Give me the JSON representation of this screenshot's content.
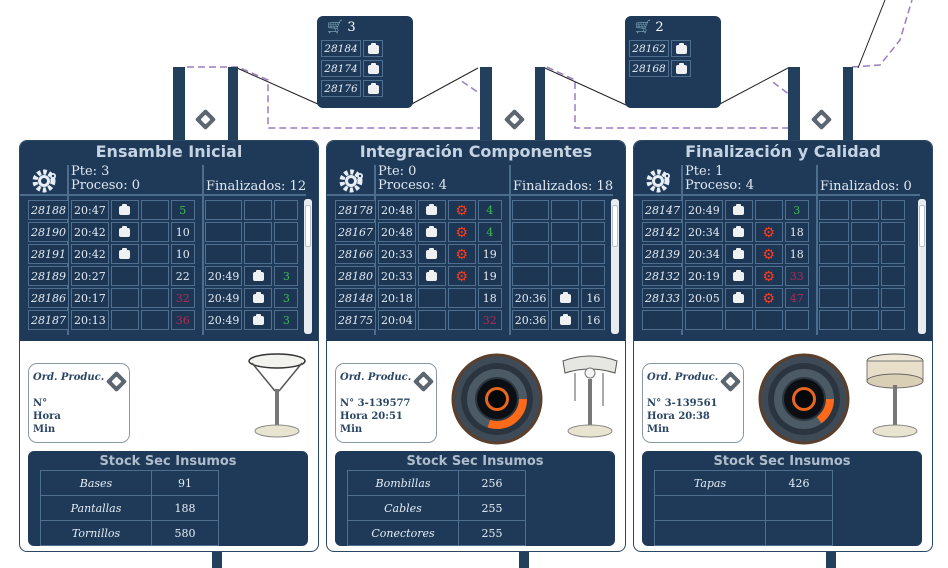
{
  "racks": [
    {
      "count": "3",
      "items": [
        "28184",
        "28174",
        "28176"
      ]
    },
    {
      "count": "2",
      "items": [
        "28162",
        "28168"
      ]
    }
  ],
  "stations": [
    {
      "title": "Ensamble Inicial",
      "pte": "Pte: 3",
      "proceso": "Proceso: 0",
      "finalizados": "Finalizados: 12",
      "rows": [
        {
          "id": "28188",
          "time": "20:47",
          "box": true,
          "gear": false,
          "num": "5",
          "numColor": "green",
          "ftime": "",
          "fbox": false,
          "fnum": "",
          "fnumColor": ""
        },
        {
          "id": "28190",
          "time": "20:42",
          "box": true,
          "gear": false,
          "num": "10",
          "numColor": "white",
          "ftime": "",
          "fbox": false,
          "fnum": "",
          "fnumColor": ""
        },
        {
          "id": "28191",
          "time": "20:42",
          "box": true,
          "gear": false,
          "num": "10",
          "numColor": "white",
          "ftime": "",
          "fbox": false,
          "fnum": "",
          "fnumColor": ""
        },
        {
          "id": "28189",
          "time": "20:27",
          "box": false,
          "gear": false,
          "num": "22",
          "numColor": "white",
          "ftime": "20:49",
          "fbox": true,
          "fnum": "3",
          "fnumColor": "green"
        },
        {
          "id": "28186",
          "time": "20:17",
          "box": false,
          "gear": false,
          "num": "32",
          "numColor": "red",
          "ftime": "20:49",
          "fbox": true,
          "fnum": "3",
          "fnumColor": "green"
        },
        {
          "id": "28187",
          "time": "20:13",
          "box": false,
          "gear": false,
          "num": "36",
          "numColor": "red",
          "ftime": "20:49",
          "fbox": true,
          "fnum": "3",
          "fnumColor": "green"
        }
      ],
      "order": {
        "title": "Ord. Produc.",
        "line1": "N°",
        "line2": "Hora",
        "line3": "Min"
      },
      "dial": null,
      "stock": {
        "title": "Stock Sec Insumos",
        "items": [
          {
            "name": "Bases",
            "value": "91"
          },
          {
            "name": "Pantallas",
            "value": "188"
          },
          {
            "name": "Tornillos",
            "value": "580"
          }
        ]
      }
    },
    {
      "title": "Integración Componentes",
      "pte": "Pte: 0",
      "proceso": "Proceso: 4",
      "finalizados": "Finalizados: 18",
      "rows": [
        {
          "id": "28178",
          "time": "20:48",
          "box": true,
          "gear": true,
          "num": "4",
          "numColor": "green",
          "ftime": "",
          "fbox": false,
          "fnum": "",
          "fnumColor": ""
        },
        {
          "id": "28167",
          "time": "20:48",
          "box": true,
          "gear": true,
          "num": "4",
          "numColor": "green",
          "ftime": "",
          "fbox": false,
          "fnum": "",
          "fnumColor": ""
        },
        {
          "id": "28166",
          "time": "20:33",
          "box": true,
          "gear": true,
          "num": "19",
          "numColor": "white",
          "ftime": "",
          "fbox": false,
          "fnum": "",
          "fnumColor": ""
        },
        {
          "id": "28180",
          "time": "20:33",
          "box": true,
          "gear": true,
          "num": "19",
          "numColor": "white",
          "ftime": "",
          "fbox": false,
          "fnum": "",
          "fnumColor": ""
        },
        {
          "id": "28148",
          "time": "20:18",
          "box": false,
          "gear": false,
          "num": "18",
          "numColor": "white",
          "ftime": "20:36",
          "fbox": true,
          "fnum": "16",
          "fnumColor": "white"
        },
        {
          "id": "28175",
          "time": "20:04",
          "box": false,
          "gear": false,
          "num": "32",
          "numColor": "red",
          "ftime": "20:36",
          "fbox": true,
          "fnum": "16",
          "fnumColor": "white"
        }
      ],
      "order": {
        "title": "Ord. Produc.",
        "line1": "N° 3-139577",
        "line2": "Hora 20:51",
        "line3": "Min"
      },
      "dial": {
        "progress": 0.3
      },
      "stock": {
        "title": "Stock Sec Insumos",
        "items": [
          {
            "name": "Bombillas",
            "value": "256"
          },
          {
            "name": "Cables",
            "value": "255"
          },
          {
            "name": "Conectores",
            "value": "255"
          }
        ]
      }
    },
    {
      "title": "Finalización y Calidad",
      "pte": "Pte: 1",
      "proceso": "Proceso: 4",
      "finalizados": "Finalizados: 0",
      "rows": [
        {
          "id": "28147",
          "time": "20:49",
          "box": true,
          "gear": false,
          "num": "3",
          "numColor": "green",
          "ftime": "",
          "fbox": false,
          "fnum": "",
          "fnumColor": ""
        },
        {
          "id": "28142",
          "time": "20:34",
          "box": true,
          "gear": true,
          "num": "18",
          "numColor": "white",
          "ftime": "",
          "fbox": false,
          "fnum": "",
          "fnumColor": ""
        },
        {
          "id": "28139",
          "time": "20:34",
          "box": true,
          "gear": true,
          "num": "18",
          "numColor": "white",
          "ftime": "",
          "fbox": false,
          "fnum": "",
          "fnumColor": ""
        },
        {
          "id": "28132",
          "time": "20:19",
          "box": true,
          "gear": true,
          "num": "33",
          "numColor": "red",
          "ftime": "",
          "fbox": false,
          "fnum": "",
          "fnumColor": ""
        },
        {
          "id": "28133",
          "time": "20:05",
          "box": true,
          "gear": true,
          "num": "47",
          "numColor": "red",
          "ftime": "",
          "fbox": false,
          "fnum": "",
          "fnumColor": ""
        },
        {
          "id": "",
          "time": "",
          "box": false,
          "gear": false,
          "num": "",
          "numColor": "white",
          "ftime": "",
          "fbox": false,
          "fnum": "",
          "fnumColor": ""
        }
      ],
      "order": {
        "title": "Ord. Produc.",
        "line1": "N° 3-139561",
        "line2": "Hora 20:38",
        "line3": "Min"
      },
      "dial": {
        "progress": 0.15
      },
      "stock": {
        "title": "Stock Sec Insumos",
        "items": [
          {
            "name": "Tapas",
            "value": "426"
          },
          {
            "name": "",
            "value": ""
          },
          {
            "name": "",
            "value": ""
          }
        ]
      }
    }
  ]
}
